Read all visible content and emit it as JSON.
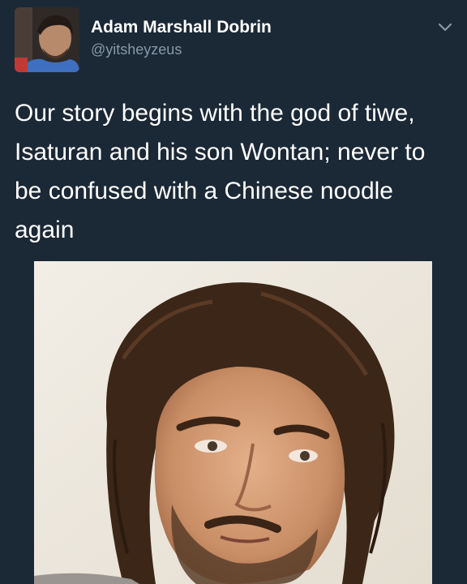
{
  "tweet": {
    "author": {
      "name": "Adam Marshall Dobrin",
      "handle": "@yitsheyzeus",
      "avatar": "profile-photo"
    },
    "menu_icon": "chevron-down-icon",
    "text": "Our story begins with the god of tiwe, Isaturan and his son Wontan; never to be confused with a Chinese noodle again",
    "media": "selfie-photo"
  },
  "colors": {
    "background": "#1b2836",
    "name": "#ffffff",
    "handle": "#8899a6",
    "text": "#ffffff",
    "chevron": "#8899a6"
  }
}
